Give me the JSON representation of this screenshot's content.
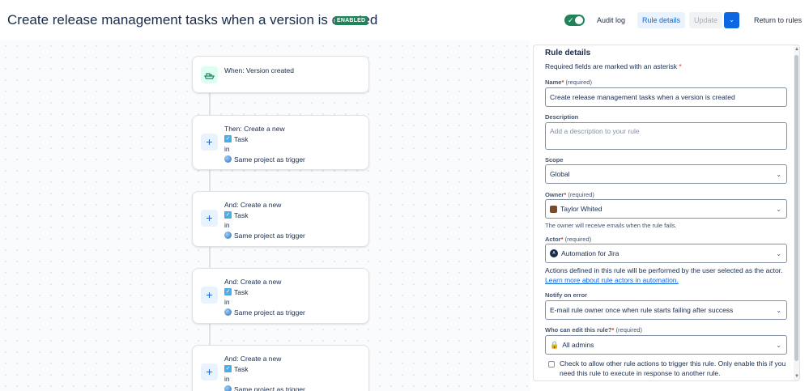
{
  "header": {
    "title": "Create release management tasks when a version is created",
    "badge": "ENABLED",
    "toggle_on": true,
    "audit_log": "Audit log",
    "rule_details": "Rule details",
    "update": "Update",
    "return": "Return to rules"
  },
  "flow": {
    "trigger": "When: Version created",
    "actions": [
      {
        "heading": "Then: Create a new",
        "issue_type": "Task",
        "in": "in",
        "project": "Same project as trigger"
      },
      {
        "heading": "And: Create a new",
        "issue_type": "Task",
        "in": "in",
        "project": "Same project as trigger"
      },
      {
        "heading": "And: Create a new",
        "issue_type": "Task",
        "in": "in",
        "project": "Same project as trigger"
      },
      {
        "heading": "And: Create a new",
        "issue_type": "Task",
        "in": "in",
        "project": "Same project as trigger"
      }
    ]
  },
  "panel": {
    "heading": "Rule details",
    "required_note": "Required fields are marked with an asterisk",
    "name": {
      "label": "Name",
      "opt": "(required)",
      "value": "Create release management tasks when a version is created"
    },
    "description": {
      "label": "Description",
      "placeholder": "Add a description to your rule"
    },
    "scope": {
      "label": "Scope",
      "value": "Global"
    },
    "owner": {
      "label": "Owner",
      "opt": "(required)",
      "value": "Taylor Whited",
      "help": "The owner will receive emails when the rule fails."
    },
    "actor": {
      "label": "Actor",
      "opt": "(required)",
      "value": "Automation for Jira",
      "help": "Actions defined in this rule will be performed by the user selected as the actor.",
      "link": "Learn more about rule actors in automation."
    },
    "notify": {
      "label": "Notify on error",
      "value": "E-mail rule owner once when rule starts failing after success"
    },
    "editors": {
      "label": "Who can edit this rule?",
      "opt": "(required)",
      "value": "All admins"
    },
    "allow_trigger": "Check to allow other rule actions to trigger this rule. Only enable this if you need this rule to execute in response to another rule."
  },
  "colors": {
    "accent": "#0c66e4",
    "enabled": "#1f845a"
  }
}
